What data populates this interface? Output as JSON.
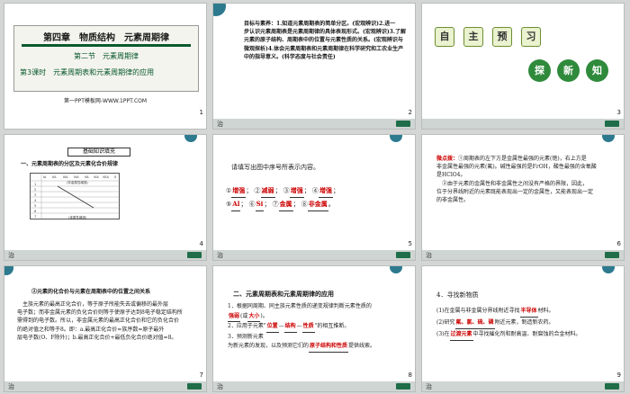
{
  "slides": [
    {
      "num": "1",
      "title": "第四章　物质结构　元素周期律",
      "section": "第二节　元素周期律",
      "lesson_prefix": "第",
      "lesson_num": "3",
      "lesson": "课时　元素周期表和元素周期律的应用",
      "website": "第一PPT模板网-WWW.1PPT.COM"
    },
    {
      "num": "2",
      "left_char": "治",
      "lines": [
        "目标与素养：1.知道元素周期表的简单分区。(宏观辨识)2.进一",
        "步认识元素周期表是元素周期律的具体表现形式。(宏观辨识)3.了解",
        "元素的原子结构、周期表中的位置与元素性质的关系。(宏观辨识与",
        "微观探析)4.体会元素周期表和元素周期律在科学研究和工农业生产",
        "中的指导意义。(科学态度与社会责任)"
      ]
    },
    {
      "num": "3",
      "boxes": [
        "自",
        "主",
        "预",
        "习"
      ],
      "circles": [
        "探",
        "新",
        "知"
      ]
    },
    {
      "num": "4",
      "left_char": "治",
      "tag": "基础知识填充",
      "heading": "一、元素周期表的分区及元素化合价规律",
      "cols": [
        "IA",
        "IIA",
        "IIIA",
        "IVA",
        "VA",
        "VIA",
        "VIIA",
        "0"
      ],
      "rows": [
        "1",
        "2",
        "3",
        "4",
        "5",
        "6",
        "7"
      ],
      "header_label": "(非金属性增强)",
      "footer_label": "(金属性增强)"
    },
    {
      "num": "5",
      "left_char": "治",
      "intro": "请填写出图中序号所表示内容。",
      "answers": [
        [
          "①",
          "增强"
        ],
        [
          "②",
          "减弱"
        ],
        [
          "③",
          "增强"
        ],
        [
          "④",
          "增强"
        ],
        [
          "⑤",
          "Al"
        ],
        [
          "⑥",
          "Si"
        ],
        [
          "⑦",
          "金属"
        ],
        [
          "⑧",
          "非金属"
        ]
      ]
    },
    {
      "num": "6",
      "left_char": "治",
      "label": "微点拨：",
      "lines": [
        "①周期表的左下方是金属性最强的元素(铯)，右上方是",
        "非金属性最强的元素(氟)。碱性最强的是FrOH，酸性最强的含氧酸",
        "是HClO4。",
        "　②由于元素的金属性和非金属性之间没有严格的界限，因此，",
        "位于分界线附近的元素既能表现出一定的金属性，又能表现出一定",
        "的非金属性。"
      ]
    },
    {
      "num": "7",
      "left_char": "治",
      "heading": "②元素的化合价与元素在周期表中的位置之间关系",
      "lines": [
        "　主族元素的最高正化合价，等于原子所能失去或偏移的最外层",
        "电子数；而非金属元素的负化合价则等于使原子达到8电子稳定结构所",
        "需得到的电子数。所以，非金属元素的最高正化合价和它的负化合价",
        "的绝对值之和等于8。即：a.最高正化合价=族序数=原子最外",
        "层电子数(O、F除外)；b.最高正化合价+最低负化合价绝对值=8。"
      ]
    },
    {
      "num": "8",
      "left_char": "治",
      "heading": "二、元素周期表和元素周期律的应用",
      "line1": "1．根据同周期、同主族元素性质的递变规律判断元素性质的",
      "b1": "强弱",
      "line2a": "(或",
      "b2": "大小",
      "line2b": ")。",
      "line3a": "2．应用于元素\"",
      "b3": "位置",
      "line3b": "—",
      "b4": "结构",
      "line3c": "—",
      "b5": "性质",
      "line3d": "\"的相互推断。",
      "line4": "3．预测新元素",
      "line5a": "为新元素的发现，以及预测它们的",
      "b6": "原子结构和性质",
      "line5b": "提供线索。"
    },
    {
      "num": "9",
      "left_char": "治",
      "heading": "4．寻找新物质",
      "l1a": "(1)在金属与非金属分界线附近寻找",
      "b1": "半导体",
      "l1b": "材料。",
      "l2a": "(2)研究",
      "b2": "氟、氯、硫、磷",
      "l2b": "附近元素，制造新农药。",
      "l3a": "(3)在",
      "b3": "过渡元素",
      "l3b": "中寻找催化剂和耐高温、耐腐蚀的合金材料。"
    }
  ],
  "colors": {
    "green": "#0a5a2e",
    "red": "#c00000",
    "bar": "#cfd5d2"
  }
}
